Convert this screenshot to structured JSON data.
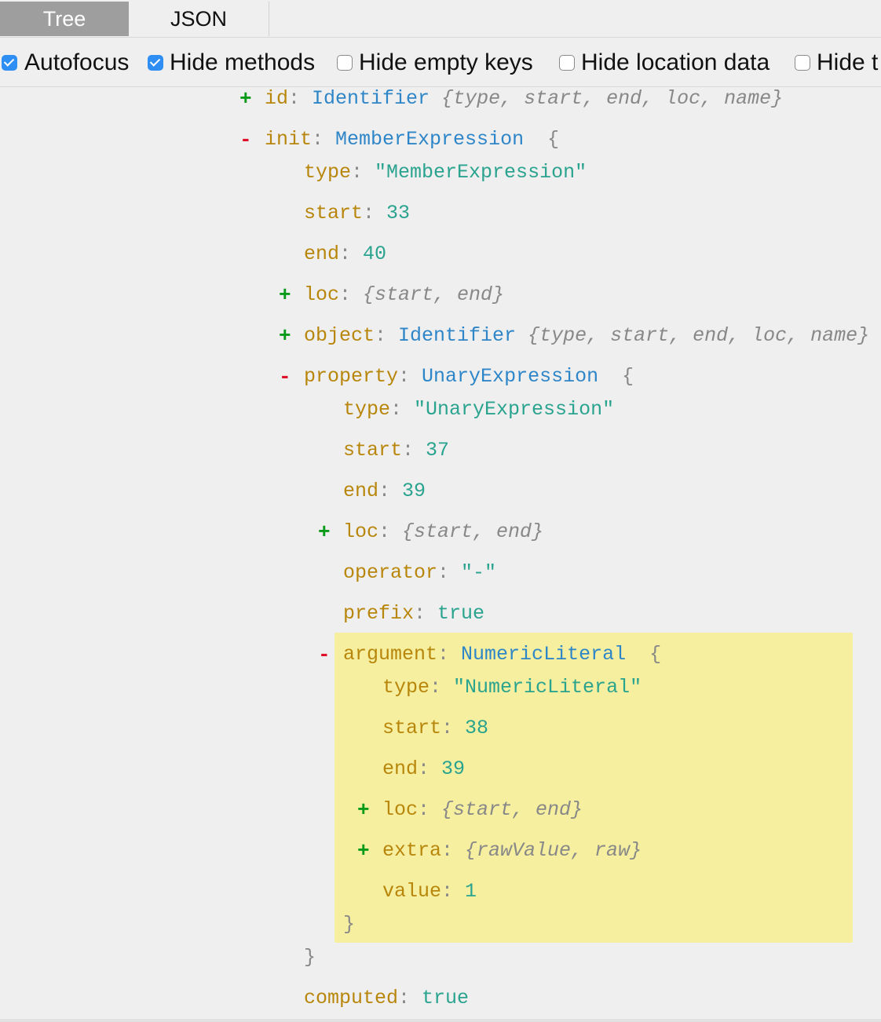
{
  "tabs": {
    "tree": "Tree",
    "json": "JSON"
  },
  "options": {
    "autofocus": {
      "label": "Autofocus",
      "checked": true
    },
    "hide_methods": {
      "label": "Hide methods",
      "checked": true
    },
    "hide_empty_keys": {
      "label": "Hide empty keys",
      "checked": false
    },
    "hide_location_data": {
      "label": "Hide location data",
      "checked": false
    },
    "hide_t": {
      "label": "Hide t",
      "checked": false
    }
  },
  "tree": {
    "id_key": "id",
    "id_type": "Identifier",
    "id_summary": "{type, start, end, loc, name}",
    "init_key": "init",
    "init_type": "MemberExpression",
    "init_type_key": "type",
    "init_type_val": "\"MemberExpression\"",
    "init_start_key": "start",
    "init_start_val": "33",
    "init_end_key": "end",
    "init_end_val": "40",
    "init_loc_key": "loc",
    "init_loc_summary": "{start, end}",
    "object_key": "object",
    "object_type": "Identifier",
    "object_summary": "{type, start, end, loc, name}",
    "property_key": "property",
    "property_type": "UnaryExpression",
    "prop_type_key": "type",
    "prop_type_val": "\"UnaryExpression\"",
    "prop_start_key": "start",
    "prop_start_val": "37",
    "prop_end_key": "end",
    "prop_end_val": "39",
    "prop_loc_key": "loc",
    "prop_loc_summary": "{start, end}",
    "operator_key": "operator",
    "operator_val": "\"-\"",
    "prefix_key": "prefix",
    "prefix_val": "true",
    "argument_key": "argument",
    "argument_type": "NumericLiteral",
    "arg_type_key": "type",
    "arg_type_val": "\"NumericLiteral\"",
    "arg_start_key": "start",
    "arg_start_val": "38",
    "arg_end_key": "end",
    "arg_end_val": "39",
    "arg_loc_key": "loc",
    "arg_loc_summary": "{start, end}",
    "extra_key": "extra",
    "extra_summary": "{rawValue, raw}",
    "value_key": "value",
    "value_val": "1",
    "computed_key": "computed",
    "computed_val": "true"
  },
  "colors": {
    "key": "#b8860b",
    "type": "#2e86c8",
    "string": "#2aa38f",
    "plus": "#0a9a1a",
    "minus": "#e0102a",
    "highlight": "#f5ef9f",
    "checkbox": "#2f8ef4"
  }
}
